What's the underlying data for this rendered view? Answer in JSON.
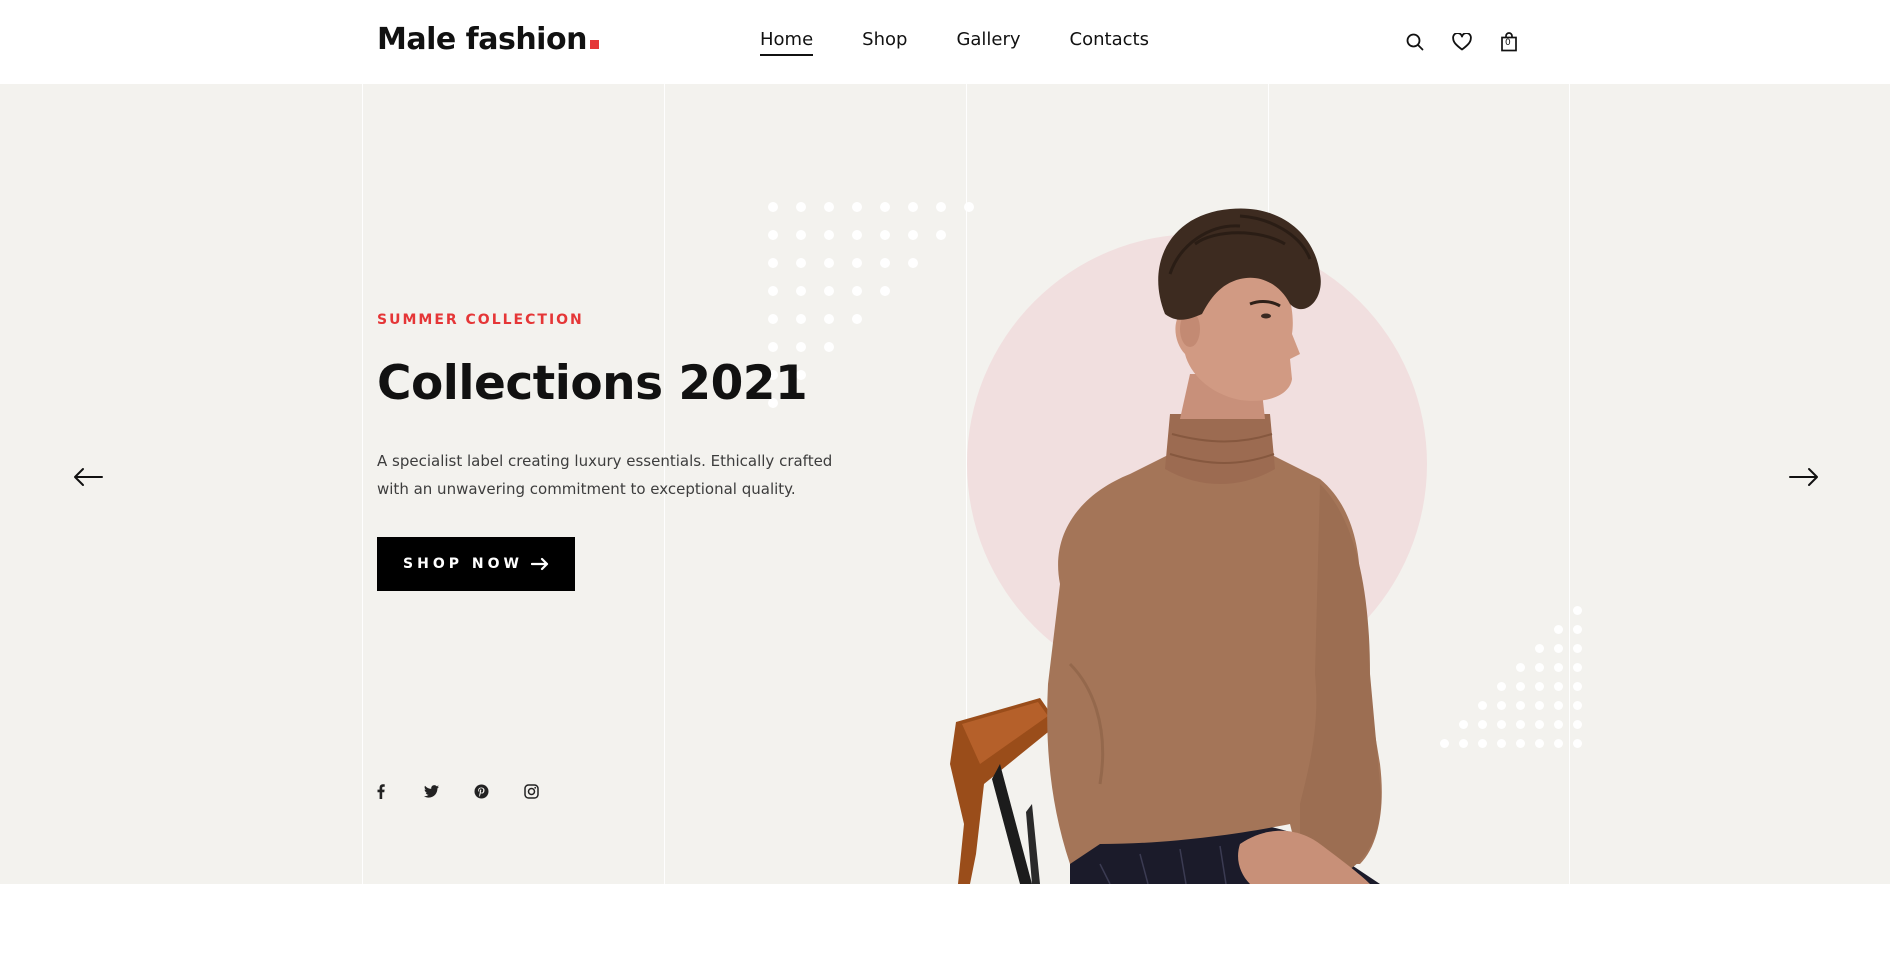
{
  "header": {
    "logo_text": "Male fashion",
    "nav": [
      {
        "label": "Home",
        "active": true
      },
      {
        "label": "Shop",
        "active": false
      },
      {
        "label": "Gallery",
        "active": false
      },
      {
        "label": "Contacts",
        "active": false
      }
    ],
    "icons": [
      "search-icon",
      "heart-icon",
      "shopping-bag-icon"
    ],
    "bag_count": "0"
  },
  "hero": {
    "subtitle": "Summer Collection",
    "title": "Collections 2021",
    "description": "A specialist label creating luxury essentials. Ethically crafted with an unwavering commitment to exceptional quality.",
    "cta_label": "SHOP NOW",
    "prev_icon": "arrow-left-icon",
    "next_icon": "arrow-right-icon",
    "social": [
      "facebook-icon",
      "twitter-icon",
      "pinterest-icon",
      "instagram-icon"
    ]
  },
  "colors": {
    "accent": "#e53637",
    "hero_bg": "#f3f2ee",
    "circle": "#f1dfdf",
    "button": "#000000",
    "sweater": "#a47558"
  }
}
